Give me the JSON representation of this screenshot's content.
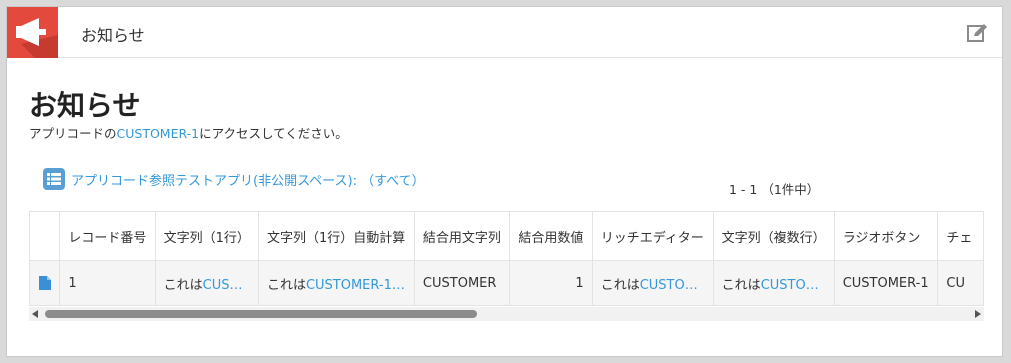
{
  "header": {
    "title": "お知らせ",
    "app_icon": "megaphone-icon",
    "edit_icon": "edit-icon"
  },
  "main": {
    "page_title": "お知らせ",
    "description_prefix": "アプリコードの",
    "description_link": "CUSTOMER-1",
    "description_suffix": "にアクセスしてください。",
    "reference_label": "アプリコード参照テストアプリ(非公開スペース): （すべて）",
    "record_count": "1 - 1 （1件中）"
  },
  "table": {
    "columns": [
      "",
      "レコード番号",
      "文字列（1行）",
      "文字列（1行）自動計算",
      "結合用文字列",
      "結合用数値",
      "リッチエディター",
      "文字列（複数行）",
      "ラジオボタン",
      "チェ"
    ],
    "rows": [
      {
        "icon": "document-icon",
        "record_number": "1",
        "text_single_prefix": "これは",
        "text_single_link": "CUS…",
        "text_auto_prefix": "これは",
        "text_auto_link": "CUSTOMER-1…",
        "join_text": "CUSTOMER",
        "join_number": "1",
        "rich_prefix": "これは",
        "rich_link": "CUSTO…",
        "multi_prefix": "これは",
        "multi_link": "CUSTO…",
        "radio": "CUSTOMER-1",
        "check": "CU"
      }
    ]
  },
  "colors": {
    "accent": "#3498db",
    "app_icon_bg": "#e4493d"
  }
}
